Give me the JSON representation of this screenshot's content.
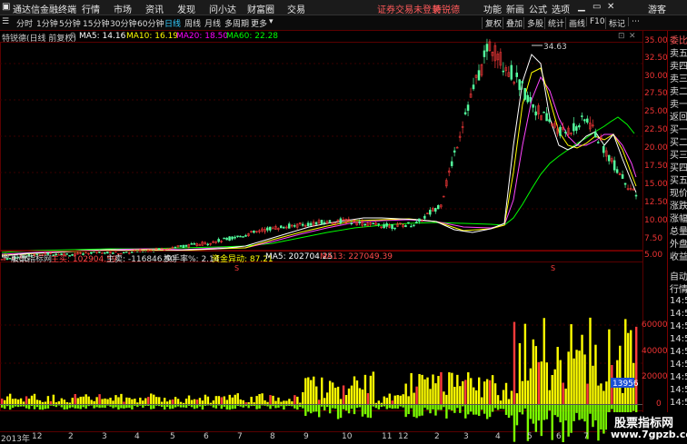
{
  "titlebar": {
    "app_name": "通达信金融终端",
    "menu": [
      "行情",
      "市场",
      "资讯",
      "发现",
      "问小达",
      "财富圈",
      "交易"
    ],
    "notice": "证券交易未登录",
    "stock_name": "特锐德",
    "right_menu": [
      "功能",
      "新画",
      "公式",
      "选项"
    ],
    "guest": "游客"
  },
  "toolbar": {
    "periods": [
      "分时",
      "1分钟",
      "5分钟",
      "15分钟",
      "30分钟",
      "60分钟",
      "日线",
      "周线",
      "月线",
      "多周期",
      "更多"
    ],
    "active_period": "日线",
    "right_buttons": [
      "复权",
      "叠加",
      "多股",
      "统计",
      "画线",
      "F10",
      "标记"
    ]
  },
  "infobar": {
    "title": "特锐德(日线 前复权)",
    "ma5": "MA5: 14.16",
    "ma10": "MA10: 16.19",
    "ma20": "MA20: 18.50",
    "ma60": "MA60: 22.28",
    "peak_label": "34.63",
    "low_label": "4.06"
  },
  "price_axis": [
    "35.00",
    "32.50",
    "30.00",
    "27.50",
    "25.00",
    "22.50",
    "20.00",
    "17.50",
    "15.00",
    "12.50",
    "10.00",
    "7.50",
    "5.00"
  ],
  "volbar": {
    "title": "股票指标网",
    "buy": "主买: 102904.59",
    "sell": "主卖: -116846.50",
    "turnover": "换手率%: 2.14",
    "anomaly": "资金异动: 87.21",
    "ma5": "MA5: 202704.25",
    "ma13": "MA13: 227049.39",
    "current_value": "13956"
  },
  "vol_axis": [
    "60000",
    "40000",
    "20000",
    "0",
    "-20000"
  ],
  "quote_panel": {
    "top": "委比",
    "rows": [
      "卖五",
      "卖四",
      "卖三",
      "卖二",
      "卖一",
      "买一",
      "买二",
      "买三",
      "买四",
      "买五",
      "现价",
      "涨跌",
      "涨幅",
      "总量",
      "外盘",
      "换手",
      "净资",
      "收益"
    ],
    "bottom_rows": [
      "自动",
      "行情",
      "14:5",
      "14:5",
      "14:5",
      "14:5",
      "14:5",
      "14:5",
      "14:5",
      "14:5",
      "14:5"
    ],
    "back": "返回"
  },
  "datebar": {
    "labels": [
      "2013年",
      "12",
      "2",
      "3",
      "4",
      "5",
      "6",
      "7",
      "8",
      "9",
      "10",
      "11",
      "12",
      "2",
      "3",
      "4",
      "5",
      "6",
      "7"
    ]
  },
  "watermark": {
    "line1": "股票指标网",
    "line2": "www.7gpzb.com"
  },
  "colors": {
    "up": "#ff3b3b",
    "down": "#54ff9f",
    "ma5": "#ffffff",
    "ma10": "#ffff00",
    "ma20": "#ff00ff",
    "ma60": "#00ff00",
    "volume_buy": "#ffff00",
    "volume_sell": "#7cfc00"
  },
  "chart_data": {
    "type": "line",
    "price_series_approx": [
      4.1,
      4.6,
      4.9,
      4.8,
      5.2,
      5.0,
      5.4,
      5.8,
      6.2,
      6.8,
      7.6,
      8.5,
      8.9,
      9.3,
      9.6,
      9.1,
      8.8,
      9.2,
      12,
      25,
      34.6,
      30,
      25,
      22,
      24,
      18,
      13
    ],
    "ylim": [
      4.06,
      35.0
    ]
  }
}
